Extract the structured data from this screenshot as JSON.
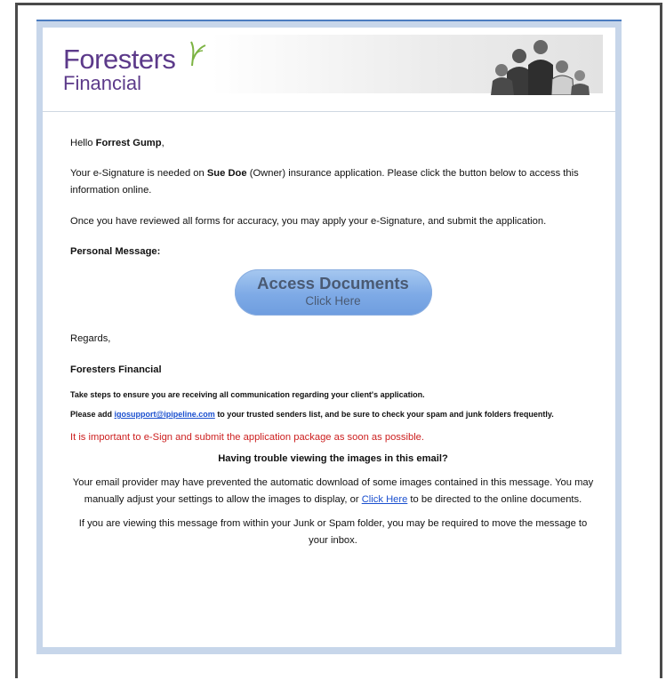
{
  "logo": {
    "brand": "Foresters",
    "sub": "Financial",
    "photo_icon": "family-photo-icon",
    "sprout_icon": "sprout-logo-icon"
  },
  "greeting": {
    "prefix": "Hello ",
    "name": "Forrest Gump",
    "suffix": ","
  },
  "para1": {
    "pre": "Your e-Signature is needed on ",
    "owner": "Sue Doe",
    "post": " (Owner) insurance application. Please click the button below to access this information online."
  },
  "para2": "Once you have reviewed all forms for accuracy, you may apply your e-Signature, and submit the application.",
  "personal_message_label": "Personal Message:",
  "button": {
    "title": "Access Documents",
    "subtitle": "Click Here"
  },
  "regards": "Regards,",
  "signature": "Foresters Financial",
  "notice1": "Take steps to ensure you are receiving all communication regarding your client's application.",
  "notice2": {
    "pre": "Please add ",
    "email": "igosupport@ipipeline.com",
    "post": " to your trusted senders list, and be sure to check your spam and junk folders frequently."
  },
  "warning": "It is important to e-Sign and submit the application package as soon as possible.",
  "trouble": {
    "heading": "Having trouble viewing the images in this email?",
    "para_pre": "Your email provider may have prevented the automatic download of some images contained in this message. You may manually adjust your settings to allow the images to display, or ",
    "link": "Click Here",
    "para_post": " to be directed to the online documents.",
    "junk": "If you are viewing this message from within your Junk or Spam folder, you may be required to move the message to your inbox."
  },
  "colors": {
    "brand_purple": "#5c3a8a",
    "link_blue": "#1a4fcf",
    "warning_red": "#cc1f1f",
    "button_blue": "#7eaae6"
  }
}
